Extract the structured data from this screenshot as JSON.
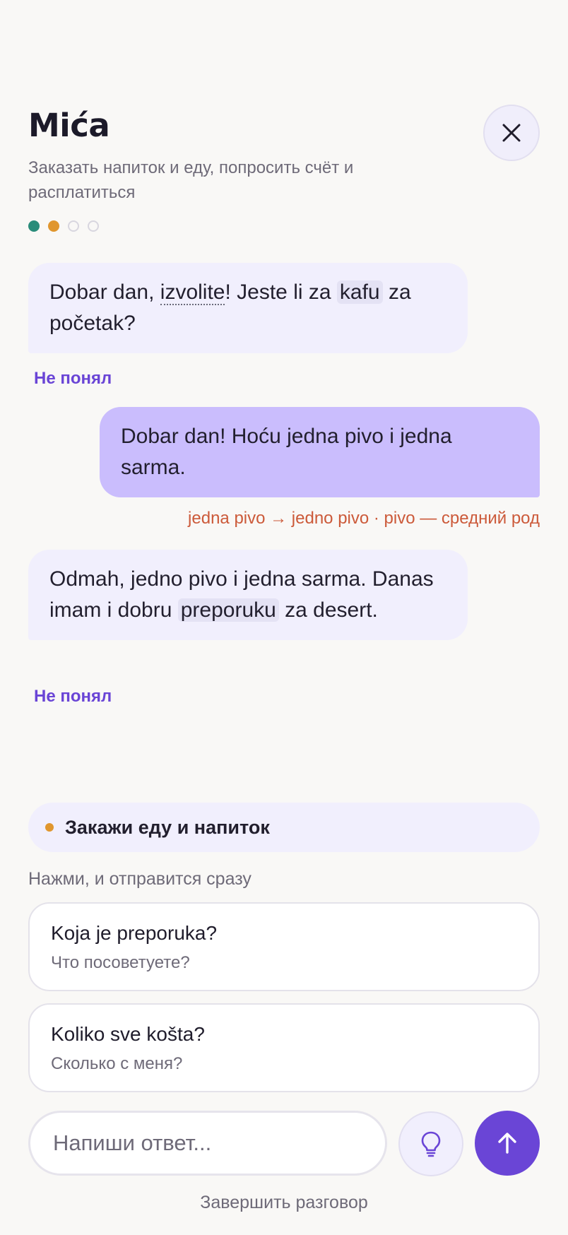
{
  "header": {
    "title": "Mića",
    "subtitle": "Заказать напиток и еду, попросить счёт и расплатиться"
  },
  "progress": {
    "total_steps": 4,
    "completed": 1,
    "current": 2
  },
  "messages": [
    {
      "role": "bot",
      "parts": [
        "Dobar dan, ",
        "izvolite",
        "! Jeste li za ",
        "kafu",
        " za početak?"
      ],
      "action": "Не понял"
    },
    {
      "role": "user",
      "text": "Dobar dan! Hoću jedna pivo i jedna sarma.",
      "correction": "jedna pivo → jedno pivo · pivo — средний род"
    },
    {
      "role": "bot",
      "parts": [
        "Odmah, jedno pivo i jedna sarma. Danas imam i dobru ",
        "preporuku",
        " za desert."
      ],
      "action": "Не понял"
    }
  ],
  "task": {
    "label": "Закажи еду и напиток",
    "color": "#e0962e"
  },
  "suggestions": {
    "hint": "Нажми, и отправится сразу",
    "items": [
      {
        "phrase": "Koja je preporuka?",
        "translation": "Что посоветуете?"
      },
      {
        "phrase": "Koliko sve košta?",
        "translation": "Сколько с меня?"
      }
    ]
  },
  "composer": {
    "placeholder": "Напиши ответ...",
    "hint_icon": "lightbulb-icon",
    "send_icon": "arrow-up-icon"
  },
  "footer": {
    "end_label": "Завершить разговор"
  },
  "colors": {
    "accent": "#6a45d6",
    "bot_bubble": "#f1effd",
    "user_bubble": "#cabdfd",
    "correction": "#cc5a3a",
    "progress_done": "#2a8c7a",
    "progress_active": "#e0962e"
  }
}
